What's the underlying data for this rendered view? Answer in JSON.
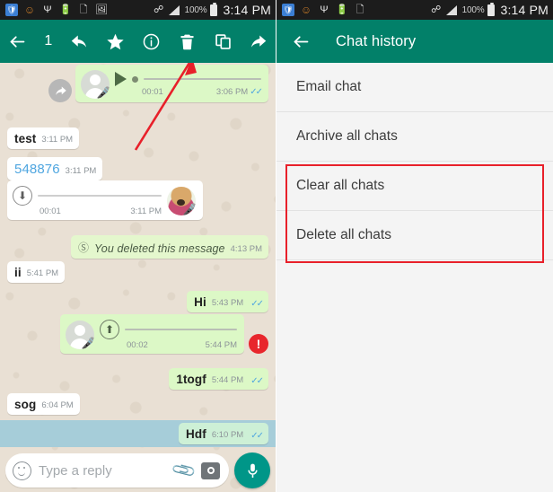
{
  "status_bar": {
    "icons": [
      "shield-icon",
      "smiley-icon",
      "usb-icon",
      "battery-saver-icon",
      "file-error-icon",
      "image-icon"
    ],
    "bluetooth": "bluetooth-icon",
    "signal": "signal-bars-icon",
    "battery_percent": "100%",
    "time": "3:14 PM"
  },
  "left_screen": {
    "appbar": {
      "back": "back-arrow-icon",
      "selected_count": "1",
      "reply": "reply-icon",
      "star": "star-icon",
      "info": "info-icon",
      "delete": "delete-trash-icon",
      "copy": "copy-icon",
      "forward": "forward-icon"
    },
    "messages": [
      {
        "id": "voice-3-06",
        "type": "voice-out",
        "forwarded": true,
        "duration": "00:01",
        "time": "3:06 PM",
        "ticks": "read",
        "state": "play"
      },
      {
        "id": "test",
        "type": "text-in",
        "text": "test",
        "time": "3:11 PM"
      },
      {
        "id": "548876",
        "type": "text-in",
        "text": "548876",
        "time": "3:11 PM",
        "style": "number"
      },
      {
        "id": "voice-3-11",
        "type": "voice-in",
        "duration": "00:01",
        "time": "3:11 PM",
        "state": "download",
        "avatar": "dog-avatar"
      },
      {
        "id": "deleted",
        "type": "deleted-out",
        "text": "You deleted this message",
        "time": "4:13 PM"
      },
      {
        "id": "ii",
        "type": "text-in",
        "text": "ii",
        "time": "5:41 PM"
      },
      {
        "id": "hi",
        "type": "text-out",
        "text": "Hi",
        "time": "5:43 PM",
        "ticks": "read"
      },
      {
        "id": "voice-5-44",
        "type": "voice-out",
        "duration": "00:02",
        "time": "5:44 PM",
        "state": "upload",
        "error": true
      },
      {
        "id": "1togf",
        "type": "text-out",
        "text": "1togf",
        "time": "5:44 PM",
        "ticks": "read"
      },
      {
        "id": "sog",
        "type": "text-in",
        "text": "sog",
        "time": "6:04 PM"
      },
      {
        "id": "hdf",
        "type": "text-out",
        "text": "Hdf",
        "time": "6:10 PM",
        "ticks": "read",
        "selected": true
      }
    ],
    "composer": {
      "emoji": "emoji-icon",
      "placeholder": "Type a reply",
      "attach": "paperclip-icon",
      "camera": "camera-icon",
      "mic": "microphone-icon"
    },
    "annotation": {
      "type": "red-arrow",
      "points_to": "delete-trash-icon"
    }
  },
  "right_screen": {
    "appbar": {
      "back": "back-arrow-icon",
      "title": "Chat history"
    },
    "menu_items": [
      {
        "label": "Email chat"
      },
      {
        "label": "Archive all chats"
      },
      {
        "label": "Clear all chats",
        "highlighted": true
      },
      {
        "label": "Delete all chats",
        "highlighted": true
      }
    ],
    "highlight_box_color": "#e8202a"
  },
  "colors": {
    "appbar_teal": "#028069",
    "outgoing_bubble": "#dcf8c6",
    "incoming_bubble": "#ffffff",
    "chat_background": "#e9e0d4",
    "selection_highlight": "#a6cdd9",
    "tick_blue": "#4fa6e0",
    "error_red": "#e8262c",
    "mic_button": "#009688",
    "annotation_red": "#e8202a"
  }
}
